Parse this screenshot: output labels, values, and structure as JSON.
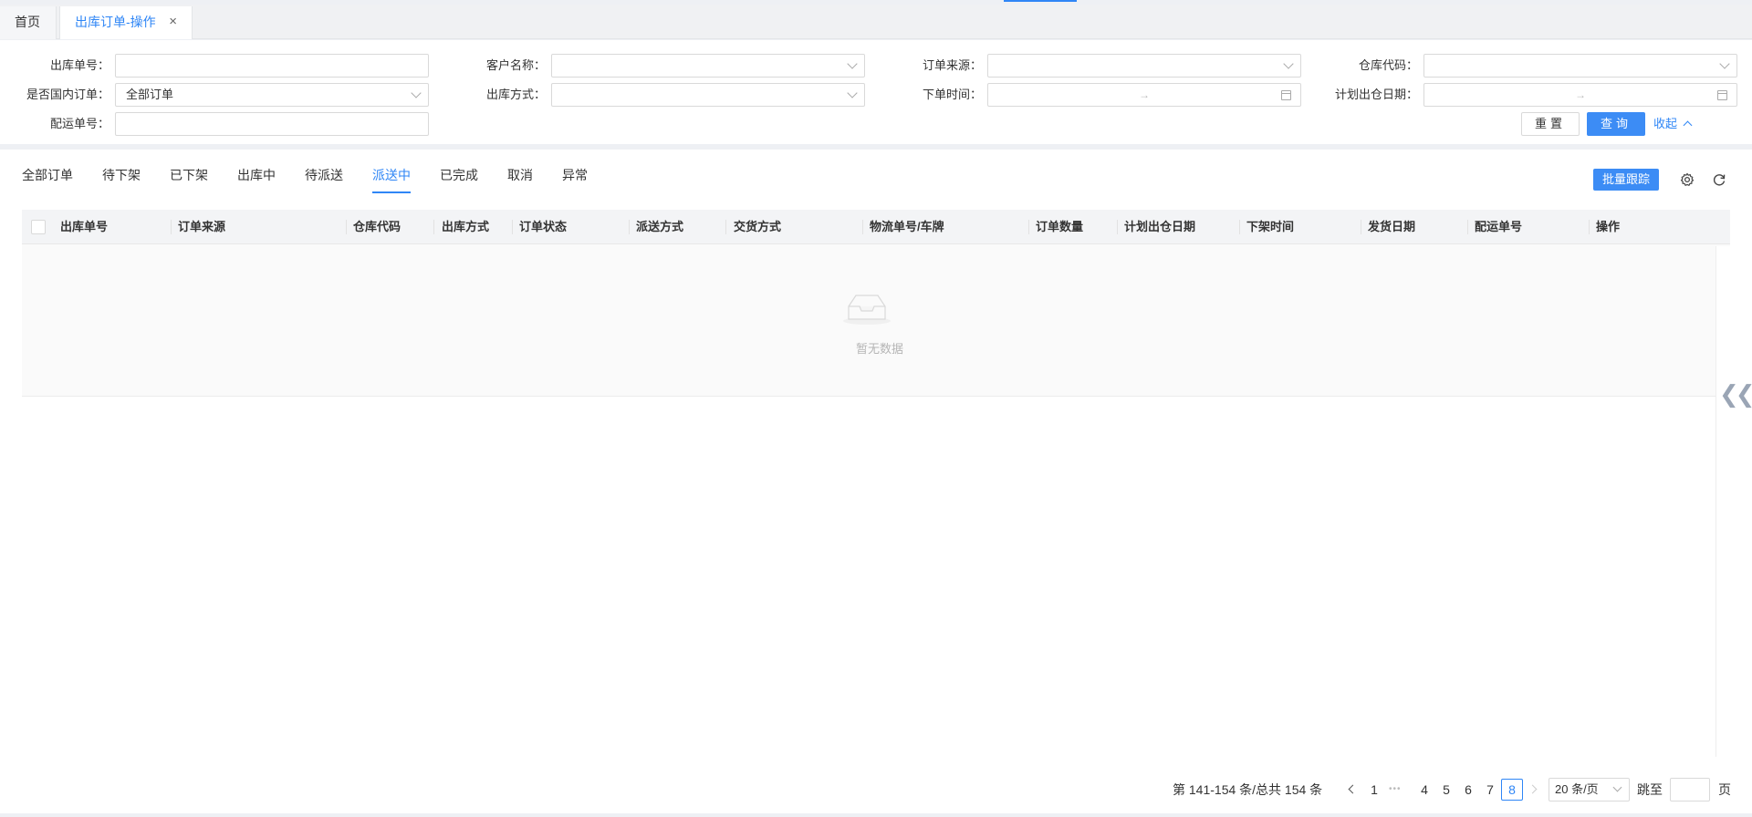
{
  "tabs": {
    "home": "首页",
    "active": "出库订单-操作",
    "close": "×"
  },
  "filters": {
    "outbound_no_label": "出库单号：",
    "customer_name_label": "客户名称：",
    "order_source_label": "订单来源：",
    "warehouse_code_label": "仓库代码：",
    "domestic_label": "是否国内订单：",
    "domestic_value": "全部订单",
    "outbound_method_label": "出库方式：",
    "order_time_label": "下单时间：",
    "planned_date_label": "计划出仓日期：",
    "delivery_no_label": "配运单号：",
    "range_arrow": "→"
  },
  "actions": {
    "reset": "重置",
    "query": "查询",
    "collapse": "收起"
  },
  "status_tabs": [
    "全部订单",
    "待下架",
    "已下架",
    "出库中",
    "待派送",
    "派送中",
    "已完成",
    "取消",
    "异常"
  ],
  "active_status_tab": "派送中",
  "toolbar": {
    "batch_track": "批量跟踪",
    "settings_icon": "gear-icon",
    "refresh_icon": "refresh-icon"
  },
  "table": {
    "columns": [
      "出库单号",
      "订单来源",
      "仓库代码",
      "出库方式",
      "订单状态",
      "派送方式",
      "交货方式",
      "物流单号/车牌",
      "订单数量",
      "计划出仓日期",
      "下架时间",
      "发货日期",
      "配运单号",
      "操作"
    ],
    "empty_text": "暂无数据"
  },
  "pagination": {
    "summary": "第 141-154 条/总共 154 条",
    "pages": [
      "1",
      "4",
      "5",
      "6",
      "7",
      "8"
    ],
    "current_page": "8",
    "ellipsis": "•••",
    "page_size": "20 条/页",
    "jump_label": "跳至",
    "page_suffix": "页"
  },
  "colors": {
    "accent": "#2f86f6",
    "primary_button": "#3c8cf5"
  }
}
